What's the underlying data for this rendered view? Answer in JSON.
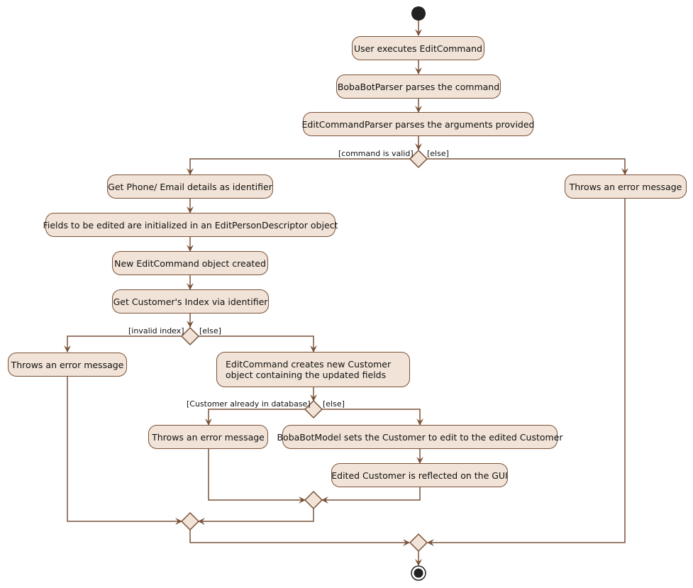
{
  "diagram": {
    "type": "activity",
    "colors": {
      "node_fill": "#f1e3d7",
      "stroke": "#7a5238",
      "start": "#222222"
    },
    "nodes": {
      "user_executes": "User executes EditCommand",
      "parser_parses": "BobaBotParser parses the command",
      "edit_parser": "EditCommandParser parses the arguments provided",
      "get_identifier": "Get Phone/ Email details as identifier",
      "fields_init": "Fields to be edited are initialized in an EditPersonDescriptor object",
      "new_command": "New EditCommand object created",
      "get_index": "Get Customer's Index via identifier",
      "error_invalid_command": "Throws an error message",
      "error_invalid_index": "Throws an error message",
      "create_customer": "EditCommand creates new Customer object containing the updated fields",
      "error_duplicate": "Throws an error message",
      "model_sets": "BobaBotModel sets the Customer to edit to the edited Customer",
      "reflected_gui": "Edited Customer is reflected on the GUI"
    },
    "guards": {
      "command_valid": "[command is valid]",
      "command_else": "[else]",
      "invalid_index": "[invalid index]",
      "index_else": "[else]",
      "already_in_db": "[Customer already in database]",
      "db_else": "[else]"
    }
  }
}
